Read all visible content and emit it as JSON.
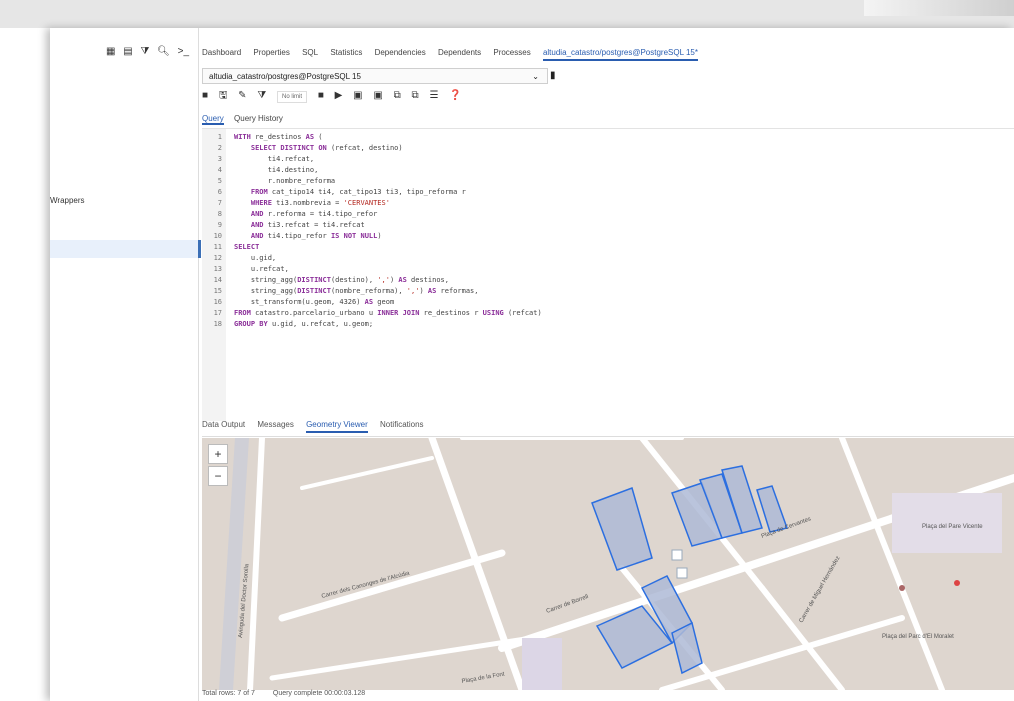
{
  "top_tabs": [
    "Dashboard",
    "Properties",
    "SQL",
    "Statistics",
    "Dependencies",
    "Dependents",
    "Processes",
    "altudia_catastro/postgres@PostgreSQL 15*"
  ],
  "left_tree": {
    "wrappers_label": "Wrappers"
  },
  "connection": {
    "value": "altudia_catastro/postgres@PostgreSQL 15"
  },
  "toolbar": {
    "limit_label": "No limit"
  },
  "query_tabs": [
    "Query",
    "Query History"
  ],
  "sql_lines": [
    {
      "n": "1",
      "t": "WITH re_destinos AS ("
    },
    {
      "n": "2",
      "t": "    SELECT DISTINCT ON (refcat, destino)"
    },
    {
      "n": "3",
      "t": "        ti4.refcat,"
    },
    {
      "n": "4",
      "t": "        ti4.destino,"
    },
    {
      "n": "5",
      "t": "        r.nombre_reforma"
    },
    {
      "n": "6",
      "t": "    FROM cat_tipo14 ti4, cat_tipo13 ti3, tipo_reforma r"
    },
    {
      "n": "7",
      "t": "    WHERE ti3.nombrevia = 'CERVANTES'"
    },
    {
      "n": "8",
      "t": "    AND r.reforma = ti4.tipo_refor"
    },
    {
      "n": "9",
      "t": "    AND ti3.refcat = ti4.refcat"
    },
    {
      "n": "10",
      "t": "    AND ti4.tipo_refor IS NOT NULL)"
    },
    {
      "n": "11",
      "t": "SELECT"
    },
    {
      "n": "12",
      "t": "    u.gid,"
    },
    {
      "n": "13",
      "t": "    u.refcat,"
    },
    {
      "n": "14",
      "t": "    string_agg(DISTINCT(destino), ',') AS destinos,"
    },
    {
      "n": "15",
      "t": "    string_agg(DISTINCT(nombre_reforma), ',') AS reformas,"
    },
    {
      "n": "16",
      "t": "    st_transform(u.geom, 4326) AS geom"
    },
    {
      "n": "17",
      "t": "FROM catastro.parcelario_urbano u INNER JOIN re_destinos r USING (refcat)"
    },
    {
      "n": "18",
      "t": "GROUP BY u.gid, u.refcat, u.geom;"
    }
  ],
  "result_tabs": [
    "Data Output",
    "Messages",
    "Geometry Viewer",
    "Notifications"
  ],
  "map": {
    "labels": [
      "Carrer dels Canonges de l'Alcúdia",
      "Carrer de Borrell",
      "Plaça de Cervantes",
      "Carrer de Miguel Hernández",
      "Plaça del Pare Vicente",
      "Plaça del Parc d'El Moralet",
      "Avinguda del Doctor Sorolla",
      "Plaça de la Font"
    ],
    "zoom_in": "+",
    "zoom_out": "−"
  },
  "status": {
    "rows": "Total rows: 7 of 7",
    "time": "Query complete 00:00:03.128"
  }
}
